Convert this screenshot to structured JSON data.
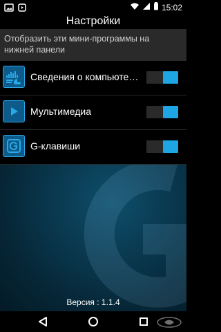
{
  "status_bar": {
    "time": "15:02",
    "icons": [
      "image-icon",
      "play-store-icon",
      "wifi-icon",
      "cellular-signal-icon",
      "battery-icon"
    ]
  },
  "header": {
    "title": "Настройки"
  },
  "section": {
    "text": "Отобразить эти мини-программы на нижней панели"
  },
  "items": [
    {
      "label": "Сведения о компьюте…",
      "icon": "system-info-icon",
      "enabled": true
    },
    {
      "label": "Мультимедиа",
      "icon": "play-icon",
      "enabled": true
    },
    {
      "label": "G-клавиши",
      "icon": "g-keys-icon",
      "enabled": true
    }
  ],
  "footer": {
    "version": "Версия : 1.1.4"
  },
  "nav": {
    "buttons": [
      "back-icon",
      "home-icon",
      "recents-icon"
    ]
  },
  "colors": {
    "accent": "#1da6e3",
    "background_top": "#000000",
    "section_bg": "#2a2a2a",
    "lower_bg": "#0b3c53"
  }
}
